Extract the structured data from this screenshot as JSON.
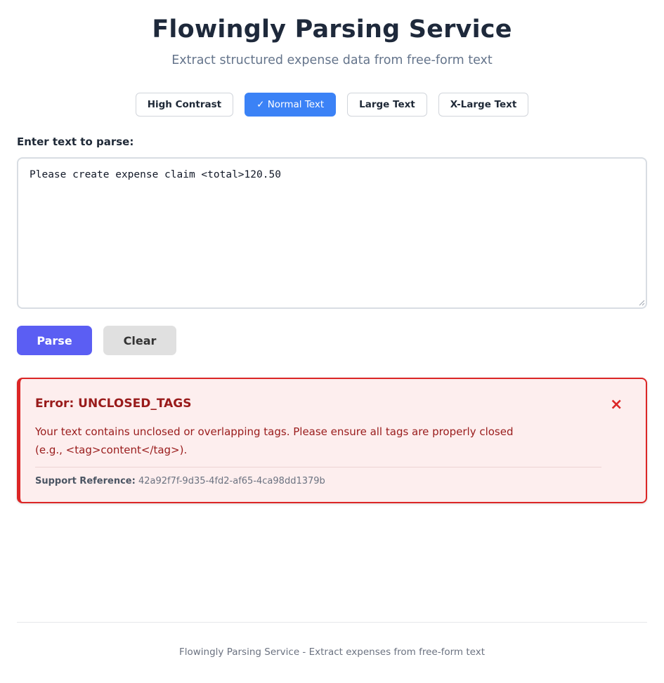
{
  "header": {
    "title": "Flowingly Parsing Service",
    "subtitle": "Extract structured expense data from free-form text"
  },
  "display_modes": [
    {
      "label": "High Contrast",
      "active": false
    },
    {
      "label": "✓ Normal Text",
      "active": true
    },
    {
      "label": "Large Text",
      "active": false
    },
    {
      "label": "X-Large Text",
      "active": false
    }
  ],
  "input": {
    "label": "Enter text to parse:",
    "value": "Please create expense claim <total>120.50"
  },
  "actions": {
    "parse_label": "Parse",
    "clear_label": "Clear"
  },
  "error": {
    "title": "Error: UNCLOSED_TAGS",
    "close_icon": "×",
    "message": "Your text contains unclosed or overlapping tags. Please ensure all tags are properly closed (e.g., <tag>content</tag>).",
    "reference_label": "Support Reference:",
    "reference_value": "42a92f7f-9d35-4fd2-af65-4ca98dd1379b"
  },
  "footer": {
    "text": "Flowingly Parsing Service - Extract expenses from free-form text"
  },
  "colors": {
    "primary": "#5b5ef3",
    "active_mode": "#3b82f6",
    "error": "#dc2626",
    "error_bg": "#fdeeee"
  }
}
